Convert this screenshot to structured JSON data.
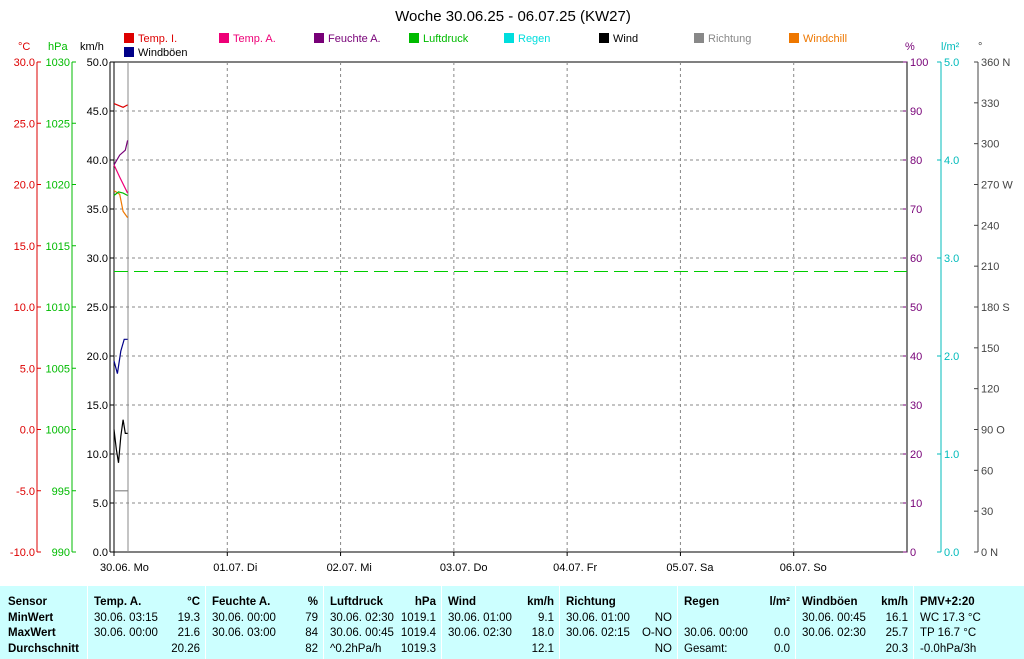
{
  "title": "Woche 30.06.25 - 06.07.25 (KW27)",
  "legend": [
    {
      "label": "Temp. I.",
      "color": "#dd0000"
    },
    {
      "label": "Temp. A.",
      "color": "#ee0077"
    },
    {
      "label": "Feuchte A.",
      "color": "#770077"
    },
    {
      "label": "Luftdruck",
      "color": "#00bb00"
    },
    {
      "label": "Regen",
      "color": "#00dddd"
    },
    {
      "label": "Wind",
      "color": "#000000"
    },
    {
      "label": "Richtung",
      "color": "#888888"
    },
    {
      "label": "Windchill",
      "color": "#ee7700"
    },
    {
      "label": "Windböen",
      "color": "#000088"
    }
  ],
  "chart_data": {
    "type": "line",
    "title": "Woche 30.06.25 - 06.07.25 (KW27)",
    "x_labels": [
      "30.06.  Mo",
      "01.07.  Di",
      "02.07.  Mi",
      "03.07.  Do",
      "04.07.  Fr",
      "05.07.  Sa",
      "06.07.  So"
    ],
    "axes": {
      "temp": {
        "unit": "°C",
        "color": "#dd0000",
        "ticks": [
          "30.0",
          "25.0",
          "20.0",
          "15.0",
          "10.0",
          "5.0",
          "0.0",
          "-5.0",
          "-10.0"
        ],
        "range": [
          -10,
          30
        ]
      },
      "pressure": {
        "unit": "hPa",
        "color": "#00bb00",
        "ticks": [
          "1030",
          "1025",
          "1020",
          "1015",
          "1010",
          "1005",
          "1000",
          "995",
          "990"
        ],
        "range": [
          990,
          1030
        ]
      },
      "wind": {
        "unit": "km/h",
        "color": "#000000",
        "ticks": [
          "50.0",
          "45.0",
          "40.0",
          "35.0",
          "30.0",
          "25.0",
          "20.0",
          "15.0",
          "10.0",
          "5.0",
          "0.0"
        ],
        "range": [
          0,
          50
        ]
      },
      "humidity": {
        "unit": "%",
        "color": "#770077",
        "ticks": [
          "100",
          "90",
          "80",
          "70",
          "60",
          "50",
          "40",
          "30",
          "20",
          "10",
          "0"
        ],
        "range": [
          0,
          100
        ]
      },
      "rain": {
        "unit": "l/m²",
        "color": "#00bbbb",
        "ticks": [
          "5.0",
          "4.0",
          "3.0",
          "2.0",
          "1.0",
          "0.0"
        ],
        "range": [
          0,
          5
        ]
      },
      "direction": {
        "unit": "°",
        "color": "#444444",
        "ticks": [
          "360 N",
          "330",
          "300",
          "270 W",
          "240",
          "210",
          "180 S",
          "150",
          "120",
          "90  O",
          "60",
          "30",
          "0    N"
        ],
        "range": [
          0,
          360
        ]
      }
    },
    "series": [
      {
        "name": "Temp. I.",
        "axis": "temp",
        "color": "#dd0000",
        "x": [
          0,
          0.08,
          0.12
        ],
        "y": [
          26.6,
          26.3,
          26.5
        ]
      },
      {
        "name": "Temp. A.",
        "axis": "temp",
        "color": "#ee0077",
        "x": [
          0,
          0.05,
          0.12
        ],
        "y": [
          21.6,
          20.6,
          19.3
        ]
      },
      {
        "name": "Feuchte A.",
        "axis": "humidity",
        "color": "#770077",
        "x": [
          0,
          0.05,
          0.1,
          0.12
        ],
        "y": [
          79,
          81,
          82,
          84
        ]
      },
      {
        "name": "Windchill",
        "axis": "temp",
        "color": "#ee7700",
        "x": [
          0,
          0.05,
          0.08,
          0.12
        ],
        "y": [
          19.5,
          19.2,
          17.8,
          17.3
        ]
      },
      {
        "name": "Luftdruck",
        "axis": "pressure",
        "color": "#00bb00",
        "x": [
          0,
          0.04,
          0.08,
          0.12
        ],
        "y": [
          1019.1,
          1019.4,
          1019.3,
          1019.1
        ]
      },
      {
        "name": "Windböen",
        "axis": "wind",
        "color": "#000088",
        "x": [
          0,
          0.03,
          0.06,
          0.09,
          0.12
        ],
        "y": [
          19.5,
          18.2,
          20.5,
          21.7,
          21.7
        ]
      },
      {
        "name": "Wind",
        "axis": "wind",
        "color": "#000000",
        "x": [
          0,
          0.02,
          0.04,
          0.06,
          0.08,
          0.1,
          0.12
        ],
        "y": [
          12.5,
          10.5,
          9.1,
          11.8,
          13.5,
          12.1,
          12.1
        ]
      },
      {
        "name": "Richtung",
        "axis": "direction",
        "color": "#888888",
        "x": [
          0,
          0.04,
          0.08,
          0.12
        ],
        "y": [
          45,
          45,
          45,
          45
        ]
      }
    ],
    "reference_line": {
      "axis": "pressure",
      "value": 1012.9,
      "color": "#00cc00",
      "dashed": true
    },
    "grid": true
  },
  "stats": {
    "row_labels": [
      "Sensor",
      "MinWert",
      "MaxWert",
      "Durchschnitt"
    ],
    "columns": [
      {
        "name": "Temp. A.",
        "unit": "°C",
        "rows": [
          [
            "30.06.  03:15",
            "19.3"
          ],
          [
            "30.06.  00:00",
            "21.6"
          ],
          [
            "",
            "20.26"
          ]
        ]
      },
      {
        "name": "Feuchte A.",
        "unit": "%",
        "rows": [
          [
            "30.06.  00:00",
            "79"
          ],
          [
            "30.06.  03:00",
            "84"
          ],
          [
            "",
            "82"
          ]
        ]
      },
      {
        "name": "Luftdruck",
        "unit": "hPa",
        "rows": [
          [
            "30.06.  02:30",
            "1019.1"
          ],
          [
            "30.06.  00:45",
            "1019.4"
          ],
          [
            "^0.2hPa/h",
            "1019.3"
          ]
        ]
      },
      {
        "name": "Wind",
        "unit": "km/h",
        "rows": [
          [
            "30.06.  01:00",
            "9.1"
          ],
          [
            "30.06.  02:30",
            "18.0"
          ],
          [
            "",
            "12.1"
          ]
        ]
      },
      {
        "name": "Richtung",
        "unit": "",
        "rows": [
          [
            "30.06.  01:00",
            "NO"
          ],
          [
            "30.06.  02:15",
            "O-NO"
          ],
          [
            "",
            "NO"
          ]
        ]
      },
      {
        "name": "Regen",
        "unit": "l/m²",
        "rows": [
          [
            "",
            ""
          ],
          [
            "30.06.  00:00",
            "0.0"
          ],
          [
            "Gesamt:",
            "0.0"
          ]
        ]
      },
      {
        "name": "Windböen",
        "unit": "km/h",
        "rows": [
          [
            "30.06.  00:45",
            "16.1"
          ],
          [
            "30.06.  02:30",
            "25.7"
          ],
          [
            "",
            "20.3"
          ]
        ]
      }
    ],
    "pmv": {
      "title": "PMV+2:20",
      "lines": [
        "WC 17.3 °C",
        "TP 16.7 °C",
        "-0.0hPa/3h"
      ]
    }
  }
}
